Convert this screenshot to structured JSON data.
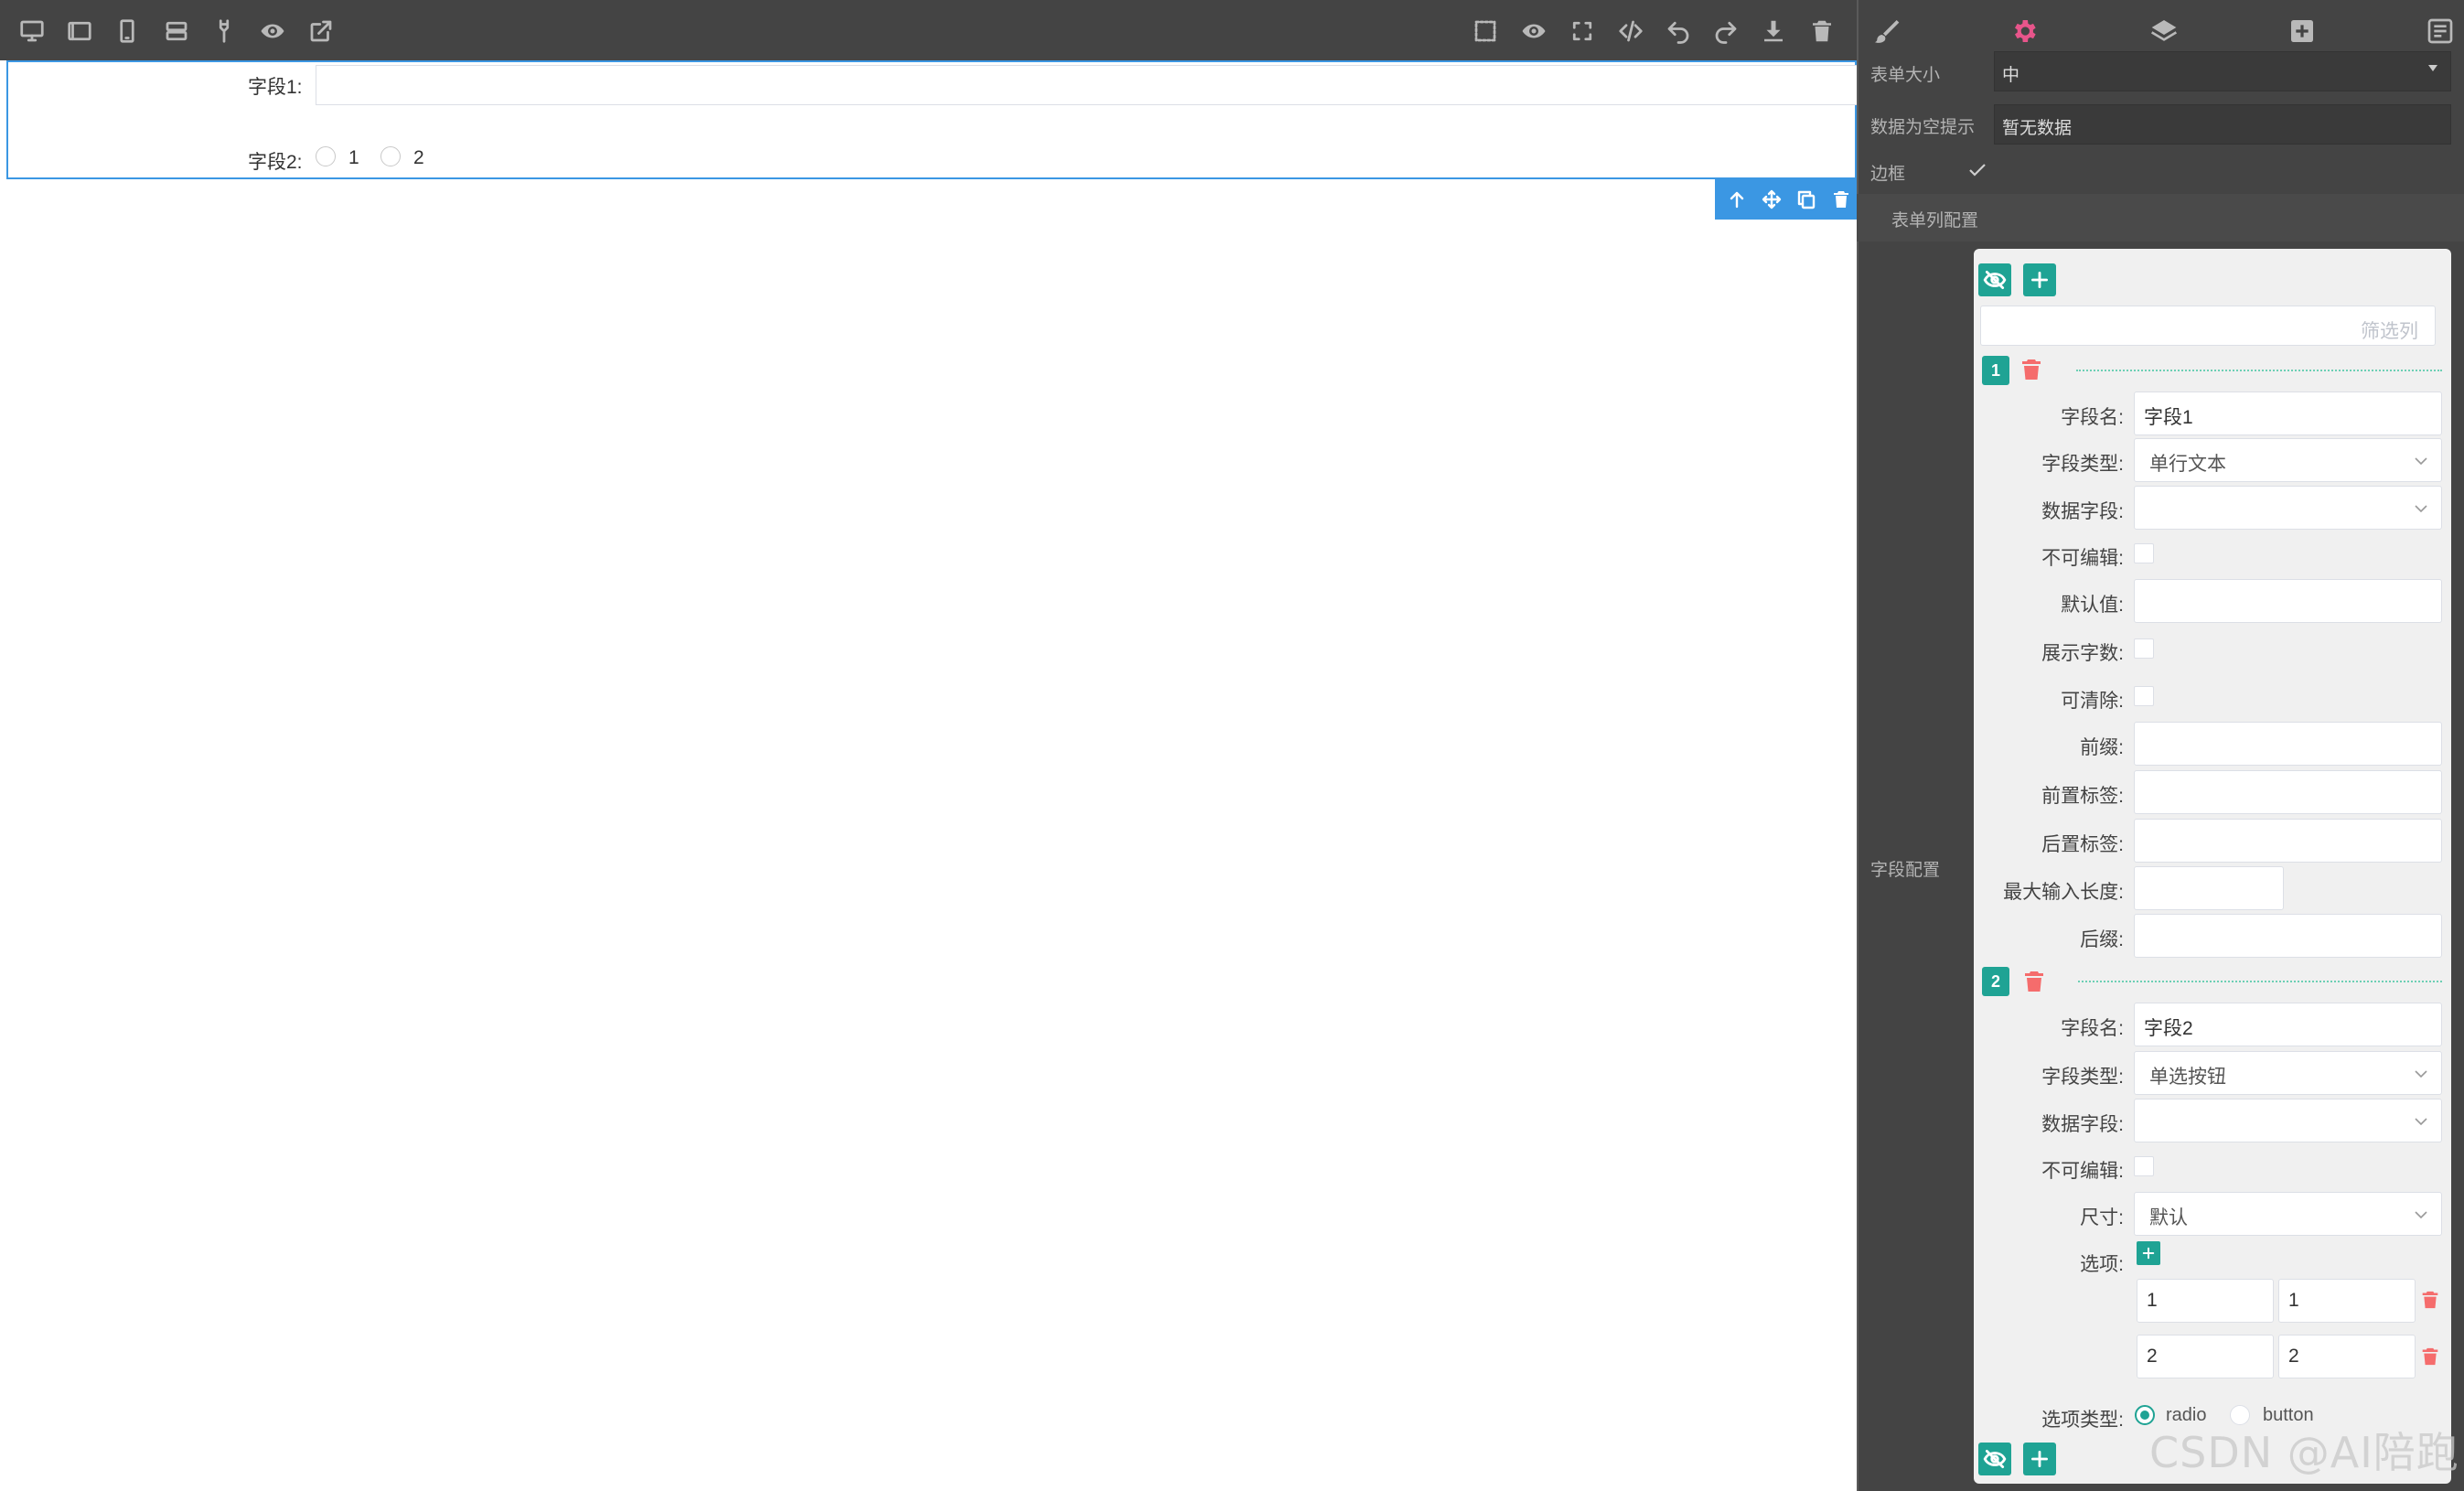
{
  "canvas": {
    "field1": {
      "label": "字段1:"
    },
    "field2": {
      "label": "字段2:",
      "options": [
        "1",
        "2"
      ]
    }
  },
  "toolbar": {
    "left_icons": [
      "monitor-icon",
      "tablet-landscape-icon",
      "mobile-icon",
      "layout-rows-icon",
      "brush-icon",
      "eye-icon",
      "external-link-icon"
    ],
    "right_icons": [
      "select-box-icon",
      "eye-icon",
      "fullscreen-icon",
      "code-icon",
      "undo-icon",
      "redo-icon",
      "download-icon",
      "trash-icon"
    ]
  },
  "panel": {
    "tabs": [
      "brush-icon",
      "gear-icon",
      "layers-icon",
      "add-block-icon",
      "list-icon"
    ],
    "active_tab_color": "#e8558b",
    "form_size": {
      "label": "表单大小",
      "value": "中"
    },
    "empty_text": {
      "label": "数据为空提示",
      "value": "暂无数据"
    },
    "border": {
      "label": "边框",
      "checked": true
    },
    "column_config_label": "表单列配置",
    "field_config_label": "字段配置",
    "filter_placeholder": "筛选列",
    "columns": [
      {
        "index": "1",
        "field_name_label": "字段名:",
        "field_name": "字段1",
        "field_type_label": "字段类型:",
        "field_type": "单行文本",
        "data_field_label": "数据字段:",
        "data_field": "",
        "readonly_label": "不可编辑:",
        "default_label": "默认值:",
        "show_count_label": "展示字数:",
        "clearable_label": "可清除:",
        "prefix_label": "前缀:",
        "prepend_label": "前置标签:",
        "append_label": "后置标签:",
        "maxlength_label": "最大输入长度:",
        "suffix_label": "后缀:"
      },
      {
        "index": "2",
        "field_name_label": "字段名:",
        "field_name": "字段2",
        "field_type_label": "字段类型:",
        "field_type": "单选按钮",
        "data_field_label": "数据字段:",
        "data_field": "",
        "readonly_label": "不可编辑:",
        "size_label": "尺寸:",
        "size": "默认",
        "options_label": "选项:",
        "options": [
          {
            "label": "1",
            "value": "1"
          },
          {
            "label": "2",
            "value": "2"
          }
        ],
        "option_type_label": "选项类型:",
        "option_types": [
          "radio",
          "button"
        ]
      }
    ]
  },
  "watermark": "CSDN @AI陪跑"
}
